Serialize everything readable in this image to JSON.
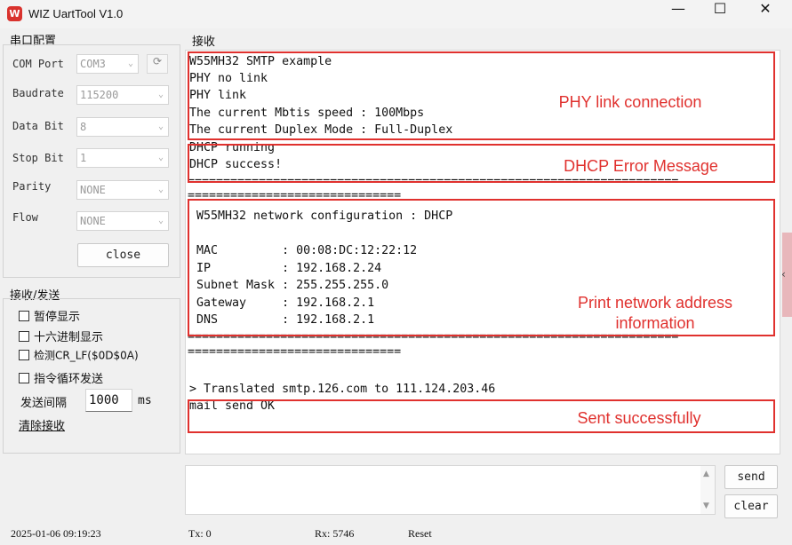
{
  "window": {
    "title": "WIZ UartTool V1.0",
    "logo_text": "W",
    "minimize": "—",
    "maximize": "☐",
    "close": "✕"
  },
  "serial_config": {
    "title": "串口配置",
    "com_port": {
      "label": "COM Port",
      "value": "COM3"
    },
    "baudrate": {
      "label": "Baudrate",
      "value": "115200"
    },
    "data_bit": {
      "label": "Data Bit",
      "value": "8"
    },
    "stop_bit": {
      "label": "Stop Bit",
      "value": "1"
    },
    "parity": {
      "label": "Parity",
      "value": "NONE"
    },
    "flow": {
      "label": "Flow",
      "value": "NONE"
    },
    "refresh_icon": "refresh-icon",
    "close_button": "close"
  },
  "recv_send": {
    "title": "接收/发送",
    "options": [
      {
        "label": "暂停显示",
        "checked": false
      },
      {
        "label": "十六进制显示",
        "checked": false
      },
      {
        "label": "检测CR_LF($0D$0A)",
        "checked": false
      },
      {
        "label": "指令循环发送",
        "checked": false
      }
    ],
    "interval_label": "发送间隔",
    "interval_value": "1000",
    "interval_unit": "ms",
    "clear_recv": "清除接收"
  },
  "receive": {
    "title": "接收",
    "lines": [
      "W55MH32 SMTP example",
      "PHY no link",
      "PHY link",
      "The current Mbtis speed : 100Mbps",
      "The current Duplex Mode : Full-Duplex",
      "DHCP running",
      "DHCP success!",
      "=====================================================================",
      "==============================",
      " W55MH32 network configuration : DHCP",
      "",
      " MAC         : 00:08:DC:12:22:12",
      " IP          : 192.168.2.24",
      " Subnet Mask : 255.255.255.0",
      " Gateway     : 192.168.2.1",
      " DNS         : 192.168.2.1",
      "=====================================================================",
      "==============================",
      "",
      "> Translated smtp.126.com to 111.124.203.46",
      "mail send OK"
    ],
    "annotations": [
      {
        "text": "PHY link connection"
      },
      {
        "text": "DHCP Error Message"
      },
      {
        "text": "Print network address information"
      },
      {
        "text": "Sent successfully"
      }
    ],
    "scroll_arrow": "‹"
  },
  "send": {
    "send_button": "send",
    "clear_button": "clear"
  },
  "status_bar": {
    "datetime": "2025-01-06 09:19:23",
    "tx": "Tx: 0",
    "rx": "Rx: 5746",
    "reset": "Reset"
  },
  "colors": {
    "annotation_red": "#e0312e",
    "logo_red": "#d9322d",
    "background": "#f0f0f0"
  }
}
